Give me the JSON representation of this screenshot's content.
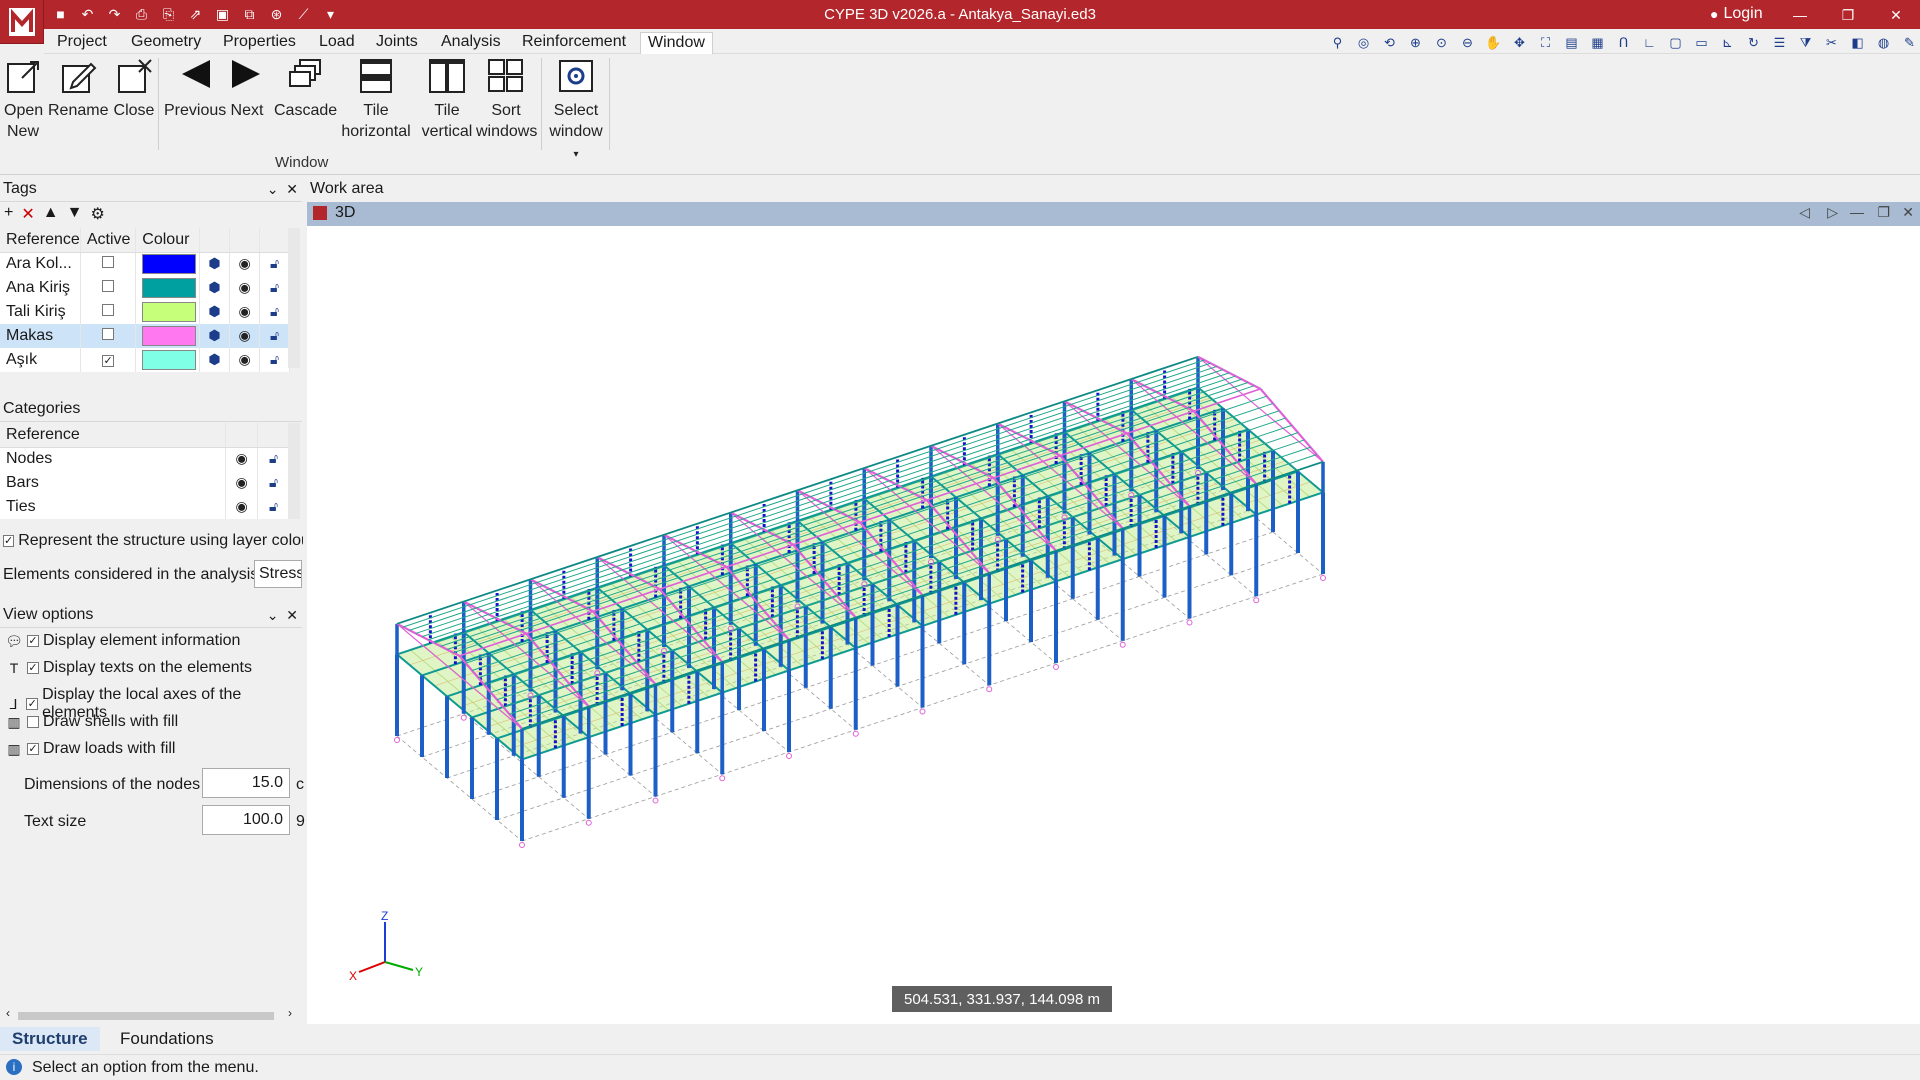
{
  "titlebar": {
    "title": "CYPE 3D v2026.a - Antakya_Sanayi.ed3",
    "login": "Login"
  },
  "menu": {
    "items": [
      "Project",
      "Geometry",
      "Properties",
      "Load",
      "Joints",
      "Analysis",
      "Reinforcement",
      "Window"
    ],
    "active": "Window"
  },
  "ribbon": {
    "buttons": [
      {
        "l1": "Open",
        "l2": "New"
      },
      {
        "l1": "Rename",
        "l2": ""
      },
      {
        "l1": "Close",
        "l2": ""
      },
      {
        "l1": "Previous",
        "l2": ""
      },
      {
        "l1": "Next",
        "l2": ""
      },
      {
        "l1": "Cascade",
        "l2": ""
      },
      {
        "l1": "Tile",
        "l2": "horizontal"
      },
      {
        "l1": "Tile",
        "l2": "vertical"
      },
      {
        "l1": "Sort",
        "l2": "windows"
      },
      {
        "l1": "Select",
        "l2": "window"
      }
    ],
    "group_label": "Window"
  },
  "tags": {
    "title": "Tags",
    "headers": [
      "Reference",
      "Active",
      "Colour"
    ],
    "rows": [
      {
        "ref": "Ara Kol...",
        "active": false,
        "color": "#0000ff"
      },
      {
        "ref": "Ana Kiriş",
        "active": false,
        "color": "#00a0a0"
      },
      {
        "ref": "Tali Kiriş",
        "active": false,
        "color": "#c6ff7a"
      },
      {
        "ref": "Makas",
        "active": false,
        "color": "#ff78f0",
        "selected": true
      },
      {
        "ref": "Aşık",
        "active": true,
        "color": "#7fffe6"
      }
    ]
  },
  "categories": {
    "title": "Categories",
    "header": "Reference",
    "rows": [
      "Nodes",
      "Bars",
      "Ties"
    ]
  },
  "represent_label": "Represent the structure using layer colou",
  "represent_checked": true,
  "elements_label": "Elements considered in the analysis",
  "elements_value": "Stress",
  "view_options": {
    "title": "View options",
    "items": [
      {
        "label": "Display element information",
        "checked": true
      },
      {
        "label": "Display texts on the elements",
        "checked": true
      },
      {
        "label": "Display the local axes of the elements",
        "checked": true
      },
      {
        "label": "Draw shells with fill",
        "checked": false
      },
      {
        "label": "Draw loads with fill",
        "checked": true
      }
    ],
    "node_dim_label": "Dimensions of the nodes",
    "node_dim_value": "15.0",
    "node_dim_unit": "c",
    "text_size_label": "Text size",
    "text_size_value": "100.0",
    "text_size_unit": "9"
  },
  "workarea": {
    "label": "Work area",
    "view_title": "3D",
    "coords": "504.531, 331.937, 144.098 m"
  },
  "axes": {
    "x": "X",
    "y": "Y",
    "z": "Z"
  },
  "bottom_tabs": [
    "Structure",
    "Foundations"
  ],
  "status": "Select an option from the menu."
}
